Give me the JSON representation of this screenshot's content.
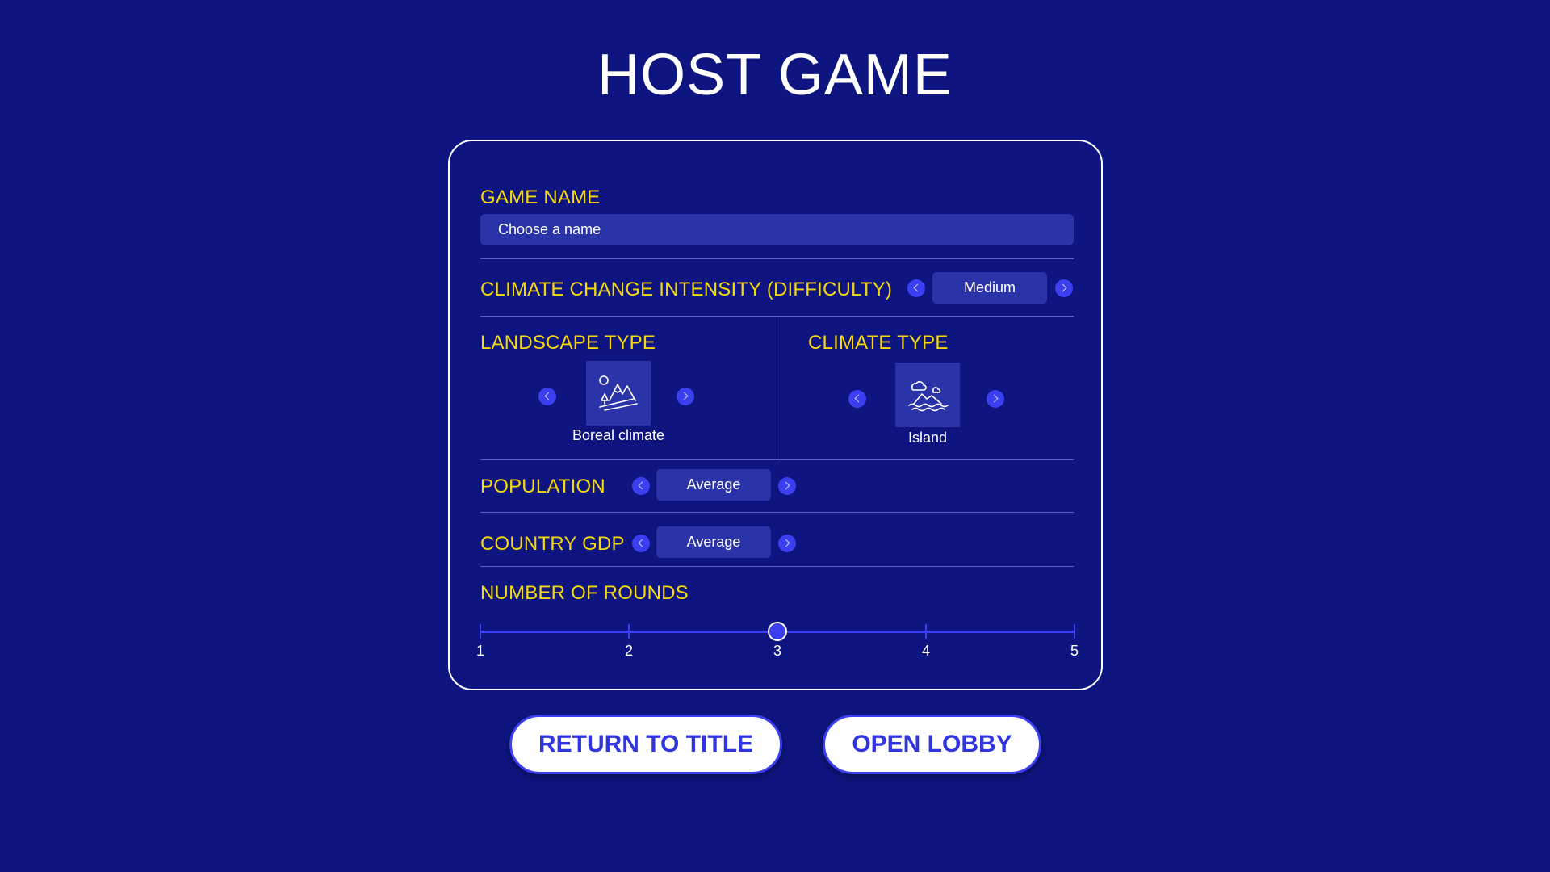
{
  "screen": {
    "title": "HOST GAME"
  },
  "form": {
    "game_name": {
      "label": "GAME NAME",
      "placeholder": "Choose a name",
      "value": ""
    },
    "difficulty": {
      "label": "CLIMATE CHANGE INTENSITY (DIFFICULTY)",
      "value": "Medium"
    },
    "landscape": {
      "label": "LANDSCAPE TYPE",
      "value": "Boreal climate",
      "icon": "mountain-landscape-icon"
    },
    "climate": {
      "label": "CLIMATE TYPE",
      "value": "Island",
      "icon": "island-climate-icon"
    },
    "population": {
      "label": "POPULATION",
      "value": "Average"
    },
    "gdp": {
      "label": "COUNTRY GDP",
      "value": "Average"
    },
    "rounds": {
      "label": "NUMBER OF ROUNDS",
      "ticks": [
        "1",
        "2",
        "3",
        "4",
        "5"
      ],
      "selected": 3
    }
  },
  "buttons": {
    "return_label": "RETURN TO TITLE",
    "open_label": "OPEN LOBBY"
  },
  "colors": {
    "background": "#0e1580",
    "accent": "#3b3ff0",
    "label": "#f5d90a",
    "field": "#2a33a8"
  }
}
